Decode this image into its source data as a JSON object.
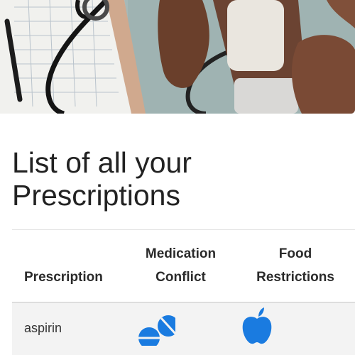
{
  "page": {
    "title": "List of all your Prescriptions"
  },
  "table": {
    "headers": {
      "prescription": "Prescription",
      "conflict_line1": "Medication",
      "conflict_line2": "Conflict",
      "food_line1": "Food",
      "food_line2": "Restrictions"
    },
    "rows": [
      {
        "name": "aspirin",
        "conflict_icon": "pills-icon",
        "food_icon": "apple-icon"
      }
    ]
  },
  "colors": {
    "icon_blue": "#1a7be0",
    "row_stripe": "#f3f3f3"
  }
}
